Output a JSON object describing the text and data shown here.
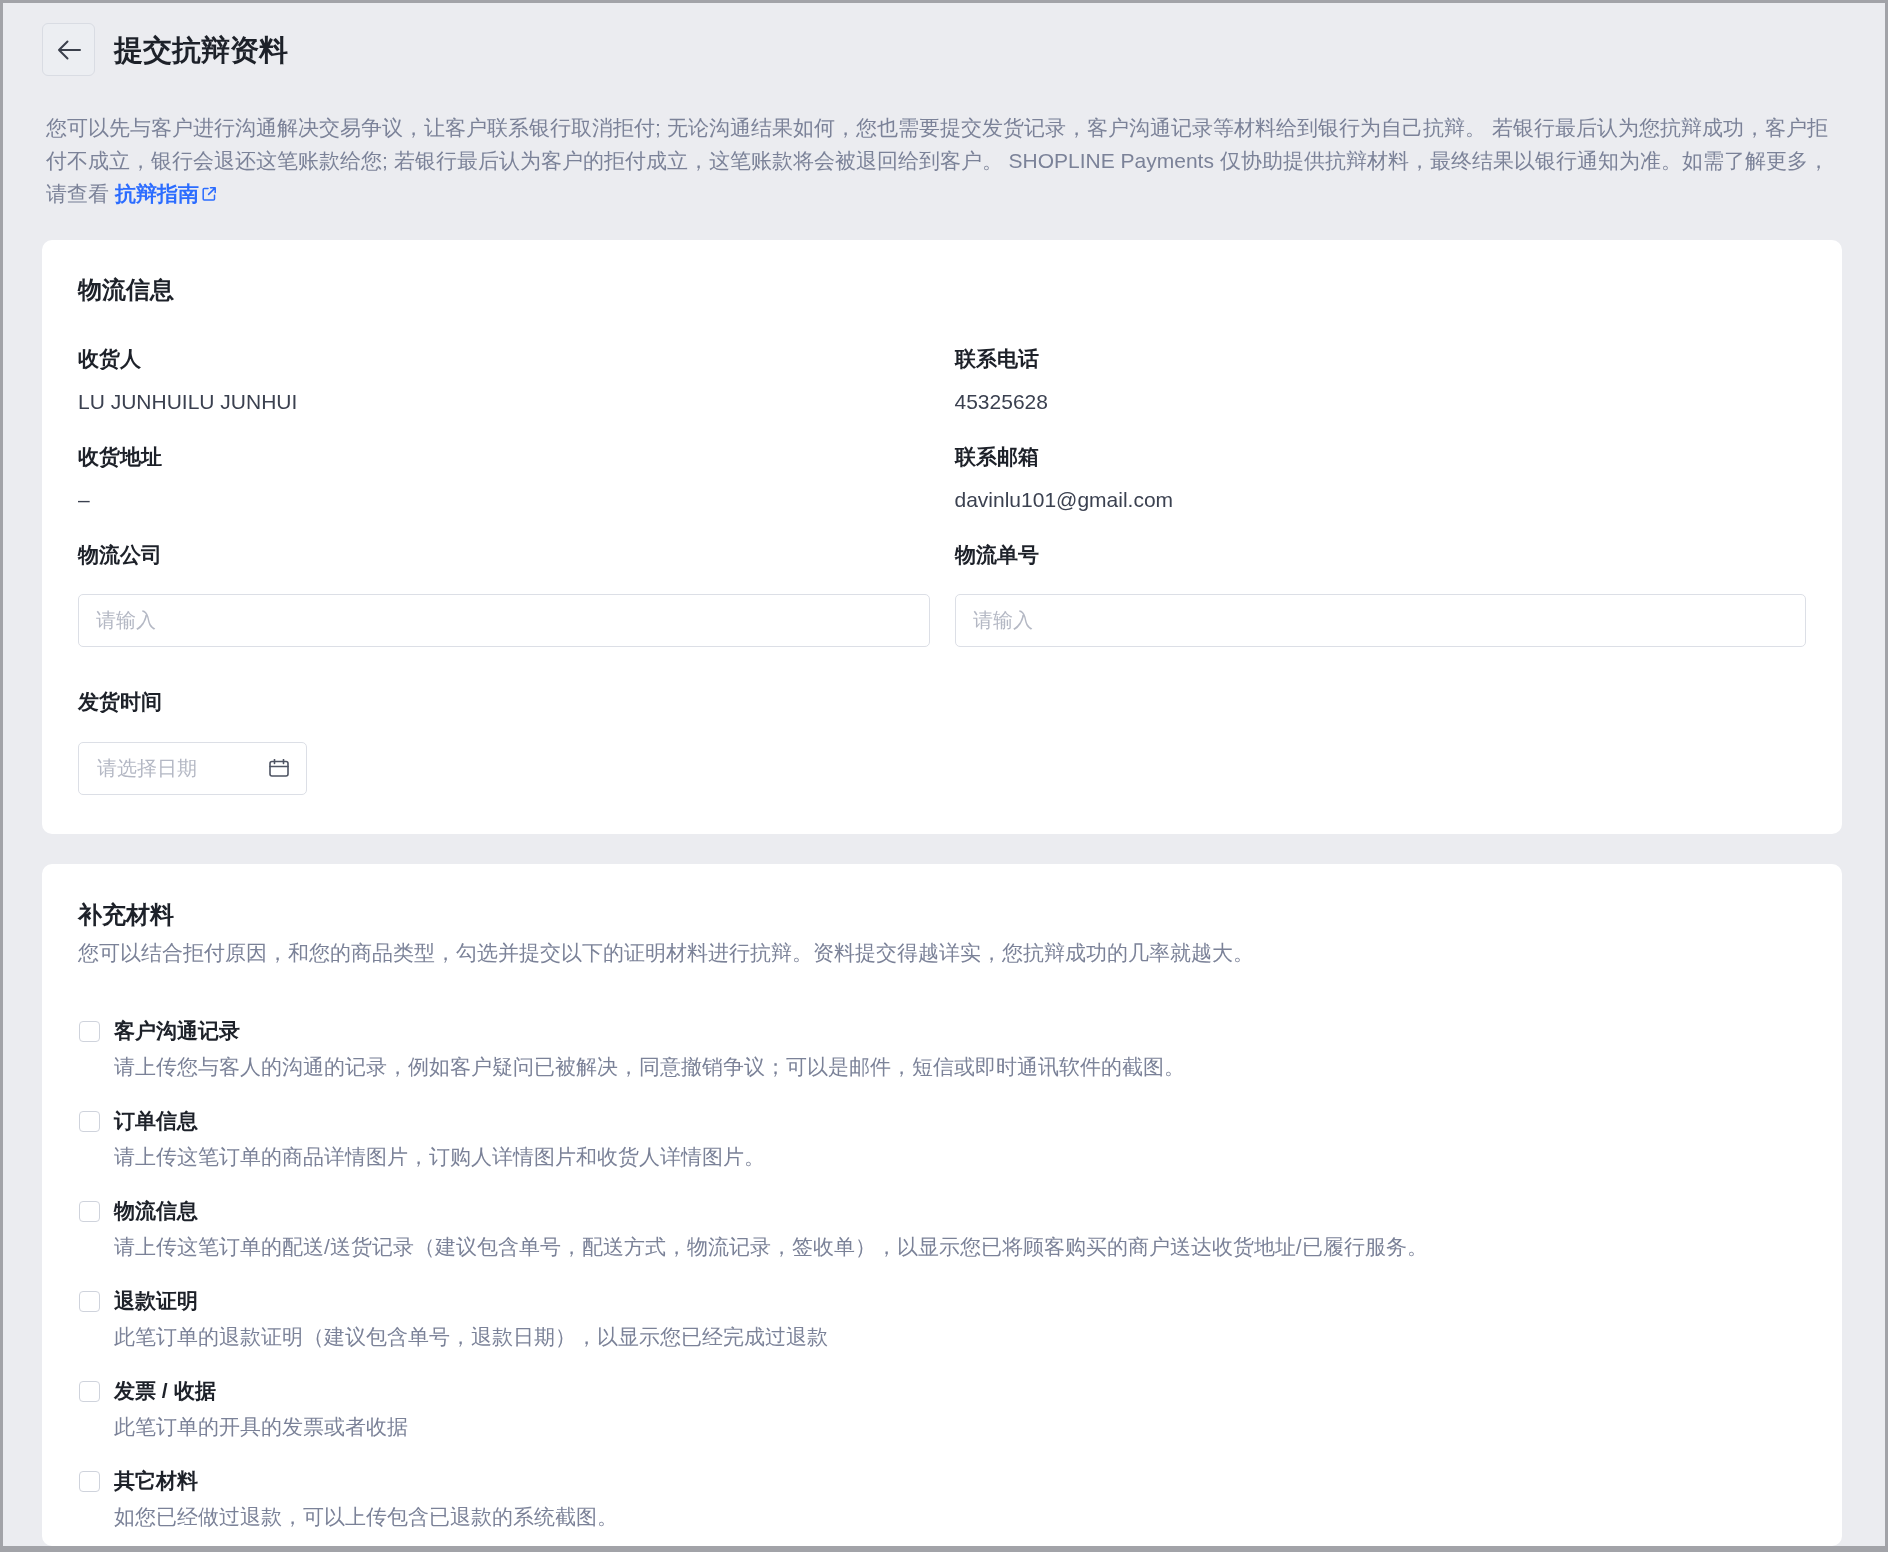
{
  "page": {
    "title": "提交抗辩资料"
  },
  "intro": {
    "text": "您可以先与客户进行沟通解决交易争议，让客户联系银行取消拒付; 无论沟通结果如何，您也需要提交发货记录，客户沟通记录等材料给到银行为自己抗辩。 若银行最后认为您抗辩成功，客户拒付不成立，银行会退还这笔账款给您; 若银行最后认为客户的拒付成立，这笔账款将会被退回给到客户。 SHOPLINE Payments 仅协助提供抗辩材料，最终结果以银行通知为准。如需了解更多，请查看",
    "link": "抗辩指南"
  },
  "logistics": {
    "title": "物流信息",
    "fields": [
      {
        "kind": "text",
        "label": "收货人",
        "value": "LU JUNHUILU JUNHUI"
      },
      {
        "kind": "text",
        "label": "联系电话",
        "value": "45325628"
      },
      {
        "kind": "text",
        "label": "收货地址",
        "value": "–"
      },
      {
        "kind": "text",
        "label": "联系邮箱",
        "value": "davinlu101@gmail.com"
      },
      {
        "kind": "input",
        "label": "物流公司",
        "placeholder": "请输入"
      },
      {
        "kind": "input",
        "label": "物流单号",
        "placeholder": "请输入"
      },
      {
        "kind": "date",
        "label": "发货时间",
        "placeholder": "请选择日期"
      }
    ]
  },
  "materials": {
    "title": "补充材料",
    "description": "您可以结合拒付原因，和您的商品类型，勾选并提交以下的证明材料进行抗辩。资料提交得越详实，您抗辩成功的几率就越大。",
    "items": [
      {
        "title": "客户沟通记录",
        "description": "请上传您与客人的沟通的记录，例如客户疑问已被解决，同意撤销争议；可以是邮件，短信或即时通讯软件的截图。",
        "checked": false
      },
      {
        "title": "订单信息",
        "description": "请上传这笔订单的商品详情图片，订购人详情图片和收货人详情图片。",
        "checked": false
      },
      {
        "title": "物流信息",
        "description": "请上传这笔订单的配送/送货记录（建议包含单号，配送方式，物流记录，签收单），以显示您已将顾客购买的商户送达收货地址/已履行服务。",
        "checked": false
      },
      {
        "title": "退款证明",
        "description": "此笔订单的退款证明（建议包含单号，退款日期），以显示您已经完成过退款",
        "checked": false
      },
      {
        "title": "发票 / 收据",
        "description": "此笔订单的开具的发票或者收据",
        "checked": false
      },
      {
        "title": "其它材料",
        "description": "如您已经做过退款，可以上传包含已退款的系统截图。",
        "checked": false
      }
    ]
  }
}
